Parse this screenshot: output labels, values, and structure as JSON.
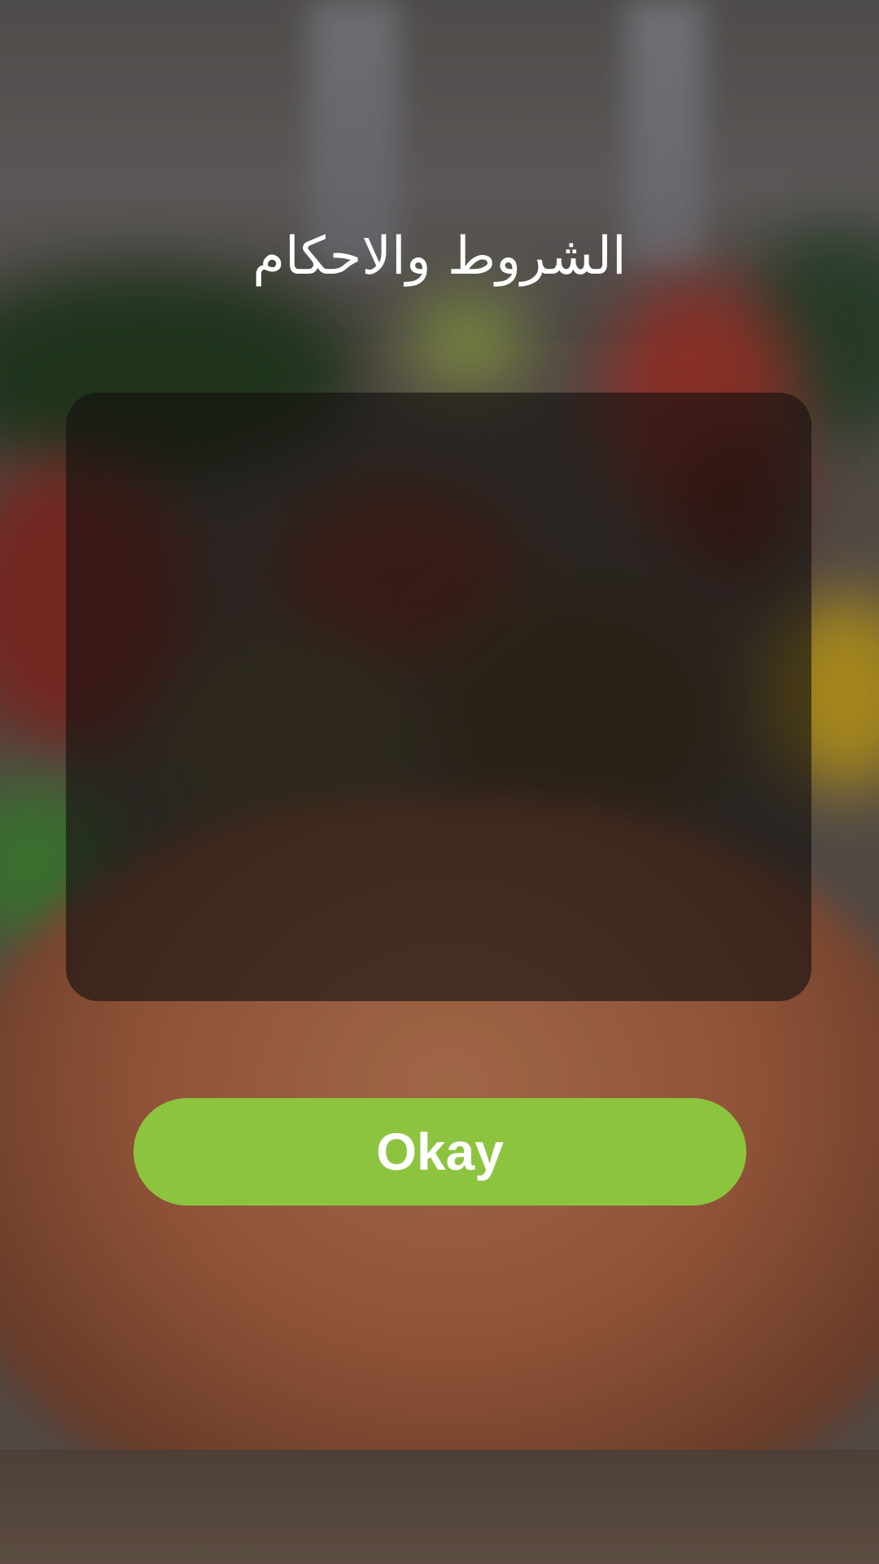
{
  "screen": {
    "title": "الشروط والاحكام",
    "terms_text": "",
    "okay_label": "Okay"
  },
  "colors": {
    "accent_button": "#8dc43f",
    "panel_overlay": "rgba(20,16,14,0.62)",
    "text": "#ffffff"
  }
}
